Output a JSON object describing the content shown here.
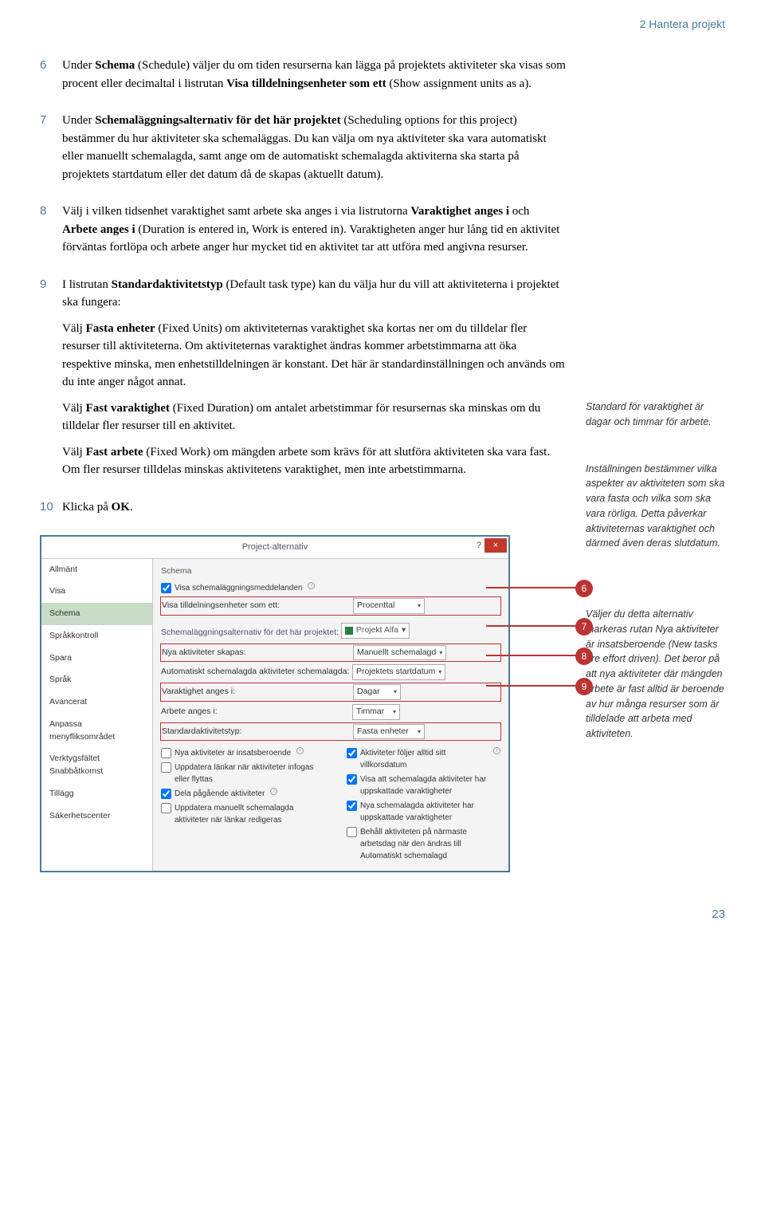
{
  "header": "2 Hantera projekt",
  "steps": {
    "s6": {
      "num": "6",
      "text_a": "Under ",
      "text_b": "Schema",
      "text_c": " (Schedule) väljer du om tiden resurserna kan lägga på projektets aktiviteter ska visas som procent eller decimaltal i listrutan ",
      "text_d": "Visa tilldelningsenheter som ett",
      "text_e": " (Show assignment units as a)."
    },
    "s7": {
      "num": "7",
      "text_a": "Under ",
      "text_b": "Schemaläggningsalternativ för det här projektet",
      "text_c": " (Scheduling options for this project) bestämmer du hur aktiviteter ska schemaläggas. Du kan välja om nya aktiviteter ska vara automatiskt eller manuellt schemalagda, samt ange om de automatiskt schemalagda aktiviterna ska starta på projektets startdatum eller det datum då de skapas (aktuellt datum)."
    },
    "s8": {
      "num": "8",
      "text_a": "Välj i vilken tidsenhet varaktighet samt arbete ska anges i via listrutorna ",
      "text_b": "Varaktighet anges i",
      "text_c": " och ",
      "text_d": "Arbete anges i",
      "text_e": " (Duration is entered in, Work is entered in). Varaktigheten anger hur lång tid en aktivitet förväntas fortlöpa och arbete anger hur mycket tid en aktivitet tar att utföra med angivna resurser."
    },
    "s9": {
      "num": "9",
      "p1_a": "I listrutan ",
      "p1_b": "Standardaktivitetstyp",
      "p1_c": " (Default task type) kan du välja hur du vill att aktiviteterna i projektet ska fungera:",
      "p2_a": "Välj ",
      "p2_b": "Fasta enheter",
      "p2_c": " (Fixed Units) om aktiviteternas varaktighet ska kortas ner om du tilldelar fler resurser till aktiviteterna. Om aktiviteternas varaktighet ändras kommer arbetstimmarna att öka respektive minska, men enhetstilldelningen är konstant. Det här är standardinställningen och används om du inte anger något annat.",
      "p3_a": "Välj ",
      "p3_b": "Fast varaktighet",
      "p3_c": " (Fixed Duration) om antalet arbetstimmar för resursernas ska minskas om du tilldelar fler resurser till en aktivitet.",
      "p4_a": "Välj ",
      "p4_b": "Fast arbete",
      "p4_c": " (Fixed Work) om mängden arbete som krävs för att slutföra aktiviteten ska vara fast. Om fler resurser tilldelas minskas aktivitetens varaktighet, men inte arbetstimmarna."
    },
    "s10": {
      "num": "10",
      "text_a": "Klicka på ",
      "text_b": "OK",
      "text_c": "."
    }
  },
  "sidenotes": {
    "n1": "Standard för varaktighet är dagar och timmar för arbete.",
    "n2": "Inställningen bestämmer vilka aspekter av aktiviteten som ska vara fasta och vilka som ska vara rörliga. Detta påverkar aktiviteternas varaktighet och därmed även deras slutdatum.",
    "n3": "Väljer du detta alternativ markeras rutan Nya aktiviteter är insatsberoende (New tasks are effort driven). Det beror på att nya aktiviteter där mängden arbete är fast alltid är beroende av hur många resurser som är tilldelade att arbeta med aktiviteten."
  },
  "dialog": {
    "title": "Project-alternativ",
    "nav": [
      "Allmänt",
      "Visa",
      "Schema",
      "Språkkontroll",
      "Spara",
      "Språk",
      "Avancerat",
      "Anpassa menyfliksområdet",
      "Verktygsfältet Snabbåtkomst",
      "Tillägg",
      "Säkerhetscenter"
    ],
    "section1": "Schema",
    "cb1": "Visa schemaläggningsmeddelanden",
    "row1_label": "Visa tilldelningsenheter som ett:",
    "row1_value": "Procenttal",
    "section2": "Schemaläggningsalternativ för det här projektet:",
    "proj": "Projekt Alfa",
    "row2_label": "Nya aktiviteter skapas:",
    "row2_value": "Manuellt schemalagd",
    "row3_label": "Automatiskt schemalagda aktiviteter schemalagda:",
    "row3_value": "Projektets startdatum",
    "row4_label": "Varaktighet anges i:",
    "row4_value": "Dagar",
    "row5_label": "Arbete anges i:",
    "row5_value": "Timmar",
    "row6_label": "Standardaktivitetstyp:",
    "row6_value": "Fasta enheter",
    "cbs_left": [
      {
        "t": "Nya aktiviteter är insatsberoende",
        "c": false
      },
      {
        "t": "Uppdatera länkar när aktiviteter infogas eller flyttas",
        "c": false
      },
      {
        "t": "Dela pågående aktiviteter",
        "c": true
      },
      {
        "t": "Uppdatera manuellt schemalagda aktiviteter när länkar redigeras",
        "c": false
      }
    ],
    "cbs_right": [
      {
        "t": "Aktiviteter följer alltid sitt villkorsdatum",
        "c": true
      },
      {
        "t": "Visa att schemalagda aktiviteter har uppskattade varaktigheter",
        "c": true
      },
      {
        "t": "Nya schemalagda aktiviteter har uppskattade varaktigheter",
        "c": true
      },
      {
        "t": "Behåll aktiviteten på närmaste arbetsdag när den ändras till Automatiskt schemalagd",
        "c": false
      }
    ]
  },
  "callouts": {
    "c6": "6",
    "c7": "7",
    "c8": "8",
    "c9": "9"
  },
  "page_number": "23"
}
